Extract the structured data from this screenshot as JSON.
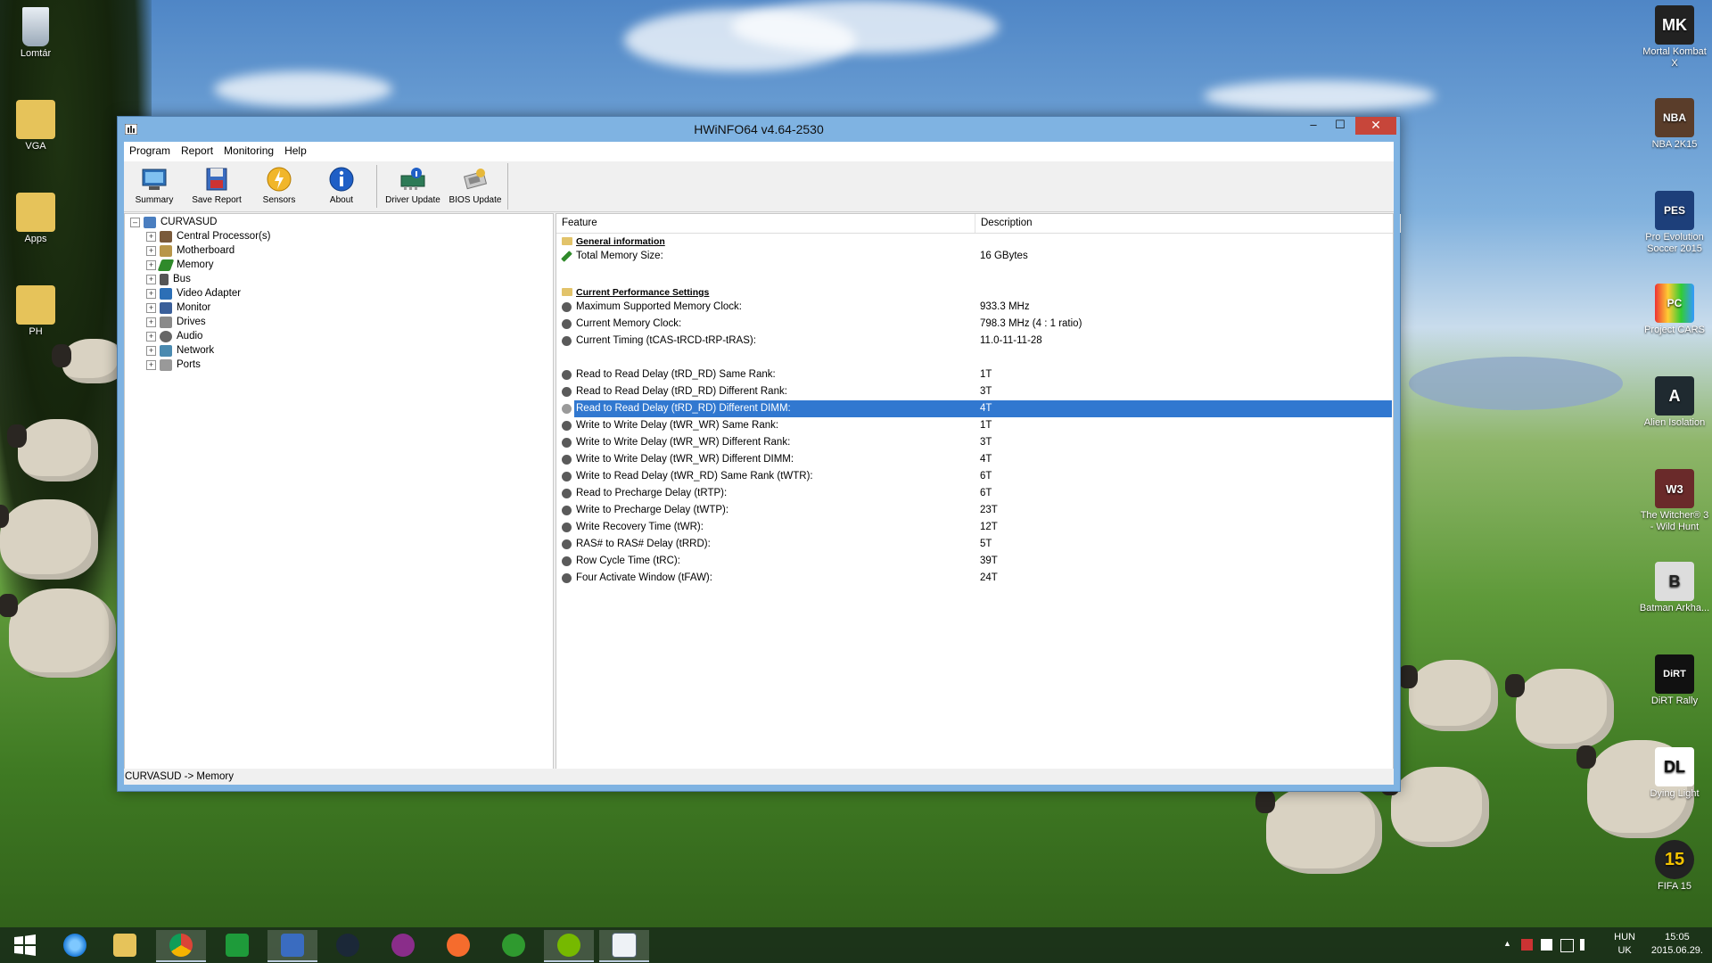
{
  "desktop": {
    "left_icons": [
      "Lomtár",
      "VGA",
      "Apps",
      "PH"
    ],
    "right_icons": [
      "Mortal Kombat X",
      "NBA 2K15",
      "Pro Evolution Soccer 2015",
      "Project CARS",
      "Alien Isolation",
      "The Witcher® 3 - Wild Hunt",
      "Batman Arkha...",
      "DiRT Rally",
      "Dying Light",
      "FIFA 15"
    ],
    "right_icon_glyphs": [
      "MK",
      "NBA",
      "PES",
      "PC",
      "A",
      "W3",
      "B",
      "DiRT",
      "DL",
      "15"
    ]
  },
  "window": {
    "title": "HWiNFO64 v4.64-2530",
    "close_glyph": "✕",
    "minimize_glyph": "–",
    "maximize_glyph": "☐",
    "menu": [
      "Program",
      "Report",
      "Monitoring",
      "Help"
    ],
    "toolbar": [
      "Summary",
      "Save Report",
      "Sensors",
      "About",
      "Driver Update",
      "BIOS Update"
    ],
    "tree": {
      "root": "CURVASUD",
      "items": [
        "Central Processor(s)",
        "Motherboard",
        "Memory",
        "Bus",
        "Video Adapter",
        "Monitor",
        "Drives",
        "Audio",
        "Network",
        "Ports"
      ]
    },
    "list": {
      "headers": [
        "Feature",
        "Description"
      ],
      "sections": {
        "general": "General information",
        "performance": "Current Performance Settings"
      },
      "rows": [
        {
          "feature": "Total Memory Size:",
          "value": "16 GBytes"
        },
        {
          "feature": "Maximum Supported Memory Clock:",
          "value": "933.3 MHz"
        },
        {
          "feature": "Current Memory Clock:",
          "value": "798.3 MHz (4 : 1 ratio)"
        },
        {
          "feature": "Current Timing (tCAS-tRCD-tRP-tRAS):",
          "value": "11.0-11-11-28"
        },
        {
          "feature": "Read to Read Delay (tRD_RD) Same Rank:",
          "value": "1T"
        },
        {
          "feature": "Read to Read Delay (tRD_RD) Different Rank:",
          "value": "3T"
        },
        {
          "feature": "Read to Read Delay (tRD_RD) Different DIMM:",
          "value": "4T"
        },
        {
          "feature": "Write to Write Delay (tWR_WR) Same Rank:",
          "value": "1T"
        },
        {
          "feature": "Write to Write Delay (tWR_WR) Different Rank:",
          "value": "3T"
        },
        {
          "feature": "Write to Write Delay (tWR_WR) Different DIMM:",
          "value": "4T"
        },
        {
          "feature": "Write to Read Delay (tWR_RD) Same Rank (tWTR):",
          "value": "6T"
        },
        {
          "feature": "Read to Precharge Delay (tRTP):",
          "value": "6T"
        },
        {
          "feature": "Write to Precharge Delay (tWTP):",
          "value": "23T"
        },
        {
          "feature": "Write Recovery Time (tWR):",
          "value": "12T"
        },
        {
          "feature": "RAS# to RAS# Delay (tRRD):",
          "value": "5T"
        },
        {
          "feature": "Row Cycle Time (tRC):",
          "value": "39T"
        },
        {
          "feature": "Four Activate Window (tFAW):",
          "value": "24T"
        }
      ]
    },
    "status": "CURVASUD -> Memory"
  },
  "taskbar": {
    "apps": [
      "Start",
      "Internet Explorer",
      "File Explorer",
      "Google Chrome",
      "Store",
      "HWiNFO Save",
      "Steam",
      "GOG Galaxy",
      "Origin",
      "Xbox",
      "uTorrent",
      "HWiNFO64"
    ],
    "tray_up_glyph": "▲",
    "language_top": "HUN",
    "language_bottom": "UK",
    "time": "15:05",
    "date": "2015.06.29."
  },
  "colors": {
    "selection": "#3178d0",
    "title_bar": "#7fb3e2",
    "close_button": "#c7463a"
  }
}
